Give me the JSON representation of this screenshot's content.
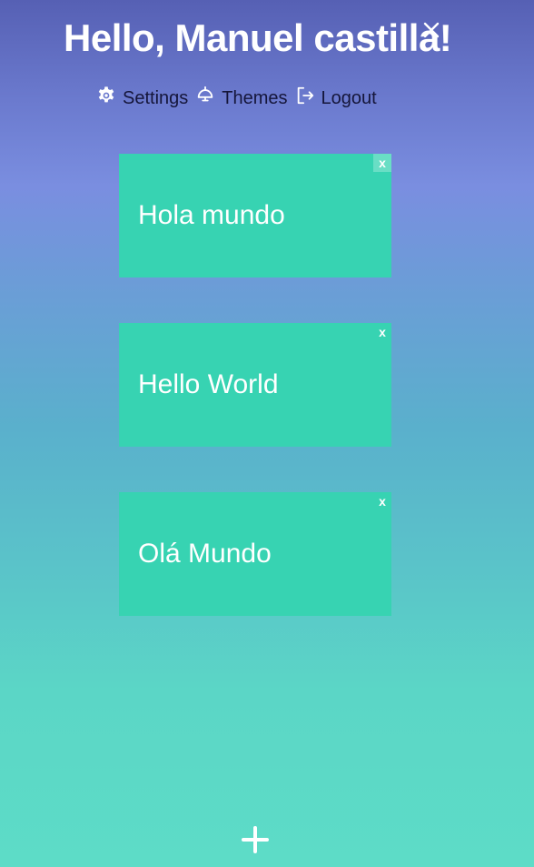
{
  "header": {
    "greeting": "Hello, Manuel castilla!"
  },
  "nav": {
    "settings": {
      "label": "Settings",
      "icon": "gear-icon"
    },
    "themes": {
      "label": "Themes",
      "icon": "lamp-icon"
    },
    "logout": {
      "label": "Logout",
      "icon": "logout-icon"
    }
  },
  "cards": [
    {
      "text": "Hola mundo",
      "close_label": "x"
    },
    {
      "text": "Hello World",
      "close_label": "x"
    },
    {
      "text": "Olá Mundo",
      "close_label": "x"
    }
  ],
  "colors": {
    "card": "#37d3b2",
    "text": "#ffffff",
    "nav_text": "#15163a"
  }
}
